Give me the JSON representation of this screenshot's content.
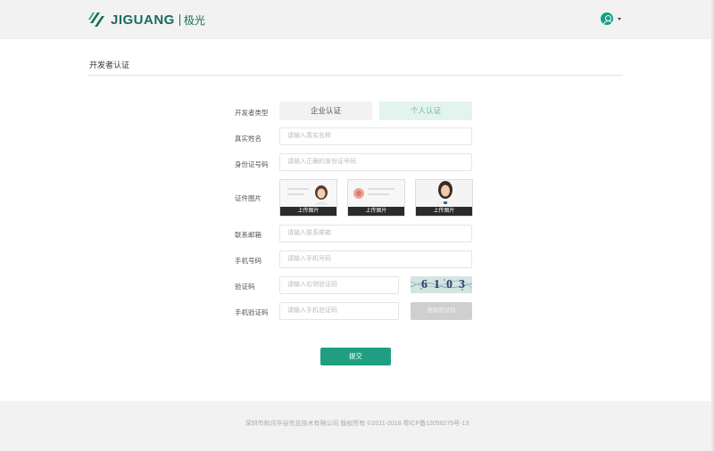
{
  "header": {
    "logo_text": "JIGUANG",
    "logo_cn": "极光",
    "user_icon": "user-circle-icon",
    "caret_icon": "caret-down-icon"
  },
  "page": {
    "title": "开发者认证"
  },
  "form": {
    "developer_type_label": "开发者类型",
    "type_options": [
      "企业认证",
      "个人认证"
    ],
    "selected_type": "个人认证",
    "real_name_label": "真实姓名",
    "real_name_placeholder": "请输入真实名称",
    "id_number_label": "身份证号码",
    "id_number_placeholder": "请输入正确的身份证号码",
    "id_photo_label": "证件图片",
    "upload_labels": [
      "上传图片",
      "上传图片",
      "上传图片"
    ],
    "email_label": "联系邮箱",
    "email_placeholder": "请输入联系邮箱",
    "phone_label": "手机号码",
    "phone_placeholder": "请输入手机号码",
    "captcha_label": "验证码",
    "captcha_placeholder": "请输入右侧验证码",
    "captcha_text": "6103",
    "sms_code_label": "手机验证码",
    "sms_code_placeholder": "请输入手机验证码",
    "get_code_label": "获取验证码",
    "submit_label": "提交"
  },
  "footer": {
    "text": "深圳市和讯华谷信息技术有限公司 版权所有 ©2011-2018 粤ICP备12056275号-13"
  },
  "colors": {
    "brand": "#1a6b5c",
    "accent": "#1f9e82",
    "selected_bg": "#e3f3ee"
  }
}
